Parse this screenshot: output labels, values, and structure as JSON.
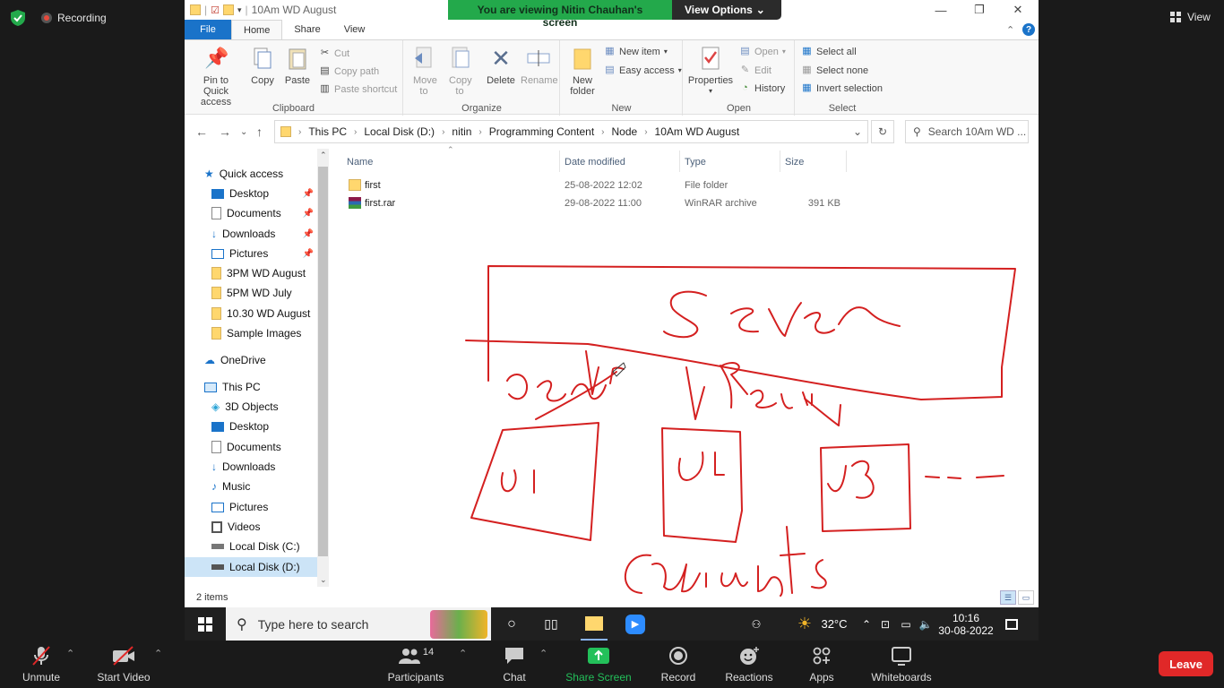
{
  "zoom": {
    "recording_label": "Recording",
    "view_label": "View",
    "banner_text": "You are viewing Nitin Chauhan's screen",
    "view_options_label": "View Options",
    "toolbar": [
      {
        "label": "Unmute",
        "icon": "mic-muted-icon"
      },
      {
        "label": "Start Video",
        "icon": "video-off-icon"
      },
      {
        "label": "Participants",
        "icon": "participants-icon",
        "count": "14"
      },
      {
        "label": "Chat",
        "icon": "chat-icon"
      },
      {
        "label": "Share Screen",
        "icon": "share-screen-icon"
      },
      {
        "label": "Record",
        "icon": "record-icon"
      },
      {
        "label": "Reactions",
        "icon": "reactions-icon"
      },
      {
        "label": "Apps",
        "icon": "apps-icon"
      },
      {
        "label": "Whiteboards",
        "icon": "whiteboard-icon"
      }
    ],
    "leave_label": "Leave",
    "colors": {
      "accent_green": "#23a94b",
      "leave_red": "#e02828"
    }
  },
  "explorer": {
    "window_title": "10Am WD August",
    "tabs": [
      "File",
      "Home",
      "Share",
      "View"
    ],
    "ribbon": {
      "clipboard": {
        "label": "Clipboard",
        "pin": "Pin to Quick access",
        "copy": "Copy",
        "paste": "Paste",
        "cut": "Cut",
        "copy_path": "Copy path",
        "paste_shortcut": "Paste shortcut"
      },
      "organize": {
        "label": "Organize",
        "move_to": "Move to",
        "copy_to": "Copy to",
        "delete": "Delete",
        "rename": "Rename"
      },
      "new": {
        "label": "New",
        "new_folder": "New folder",
        "new_item": "New item",
        "easy_access": "Easy access"
      },
      "open": {
        "label": "Open",
        "properties": "Properties",
        "open": "Open",
        "edit": "Edit",
        "history": "History"
      },
      "select": {
        "label": "Select",
        "select_all": "Select all",
        "select_none": "Select none",
        "invert": "Invert selection"
      }
    },
    "breadcrumb": [
      "This PC",
      "Local Disk (D:)",
      "nitin",
      "Programming Content",
      "Node",
      "10Am WD August"
    ],
    "search_placeholder": "Search 10Am WD ...",
    "nav": {
      "quick_access": "Quick access",
      "quick_items": [
        "Desktop",
        "Documents",
        "Downloads",
        "Pictures",
        "3PM WD August",
        "5PM WD July",
        "10.30 WD August",
        "Sample Images"
      ],
      "onedrive": "OneDrive",
      "this_pc": "This PC",
      "pc_items": [
        "3D Objects",
        "Desktop",
        "Documents",
        "Downloads",
        "Music",
        "Pictures",
        "Videos",
        "Local Disk (C:)",
        "Local Disk (D:)"
      ]
    },
    "columns": [
      "Name",
      "Date modified",
      "Type",
      "Size"
    ],
    "files": [
      {
        "name": "first",
        "date": "25-08-2022 12:02",
        "type": "File folder",
        "size": ""
      },
      {
        "name": "first.rar",
        "date": "29-08-2022 11:00",
        "type": "WinRAR archive",
        "size": "391 KB"
      }
    ],
    "status": "2 items"
  },
  "taskbar": {
    "search_placeholder": "Type here to search",
    "weather": "32°C",
    "time": "10:16",
    "date": "30-08-2022"
  },
  "annotations": {
    "server_label": "Server",
    "request_label": "Request",
    "clients": [
      "U1",
      "U2",
      "U3"
    ],
    "clients_label": "Clients",
    "ellipsis": "- - -",
    "ink_color": "#d42020"
  }
}
